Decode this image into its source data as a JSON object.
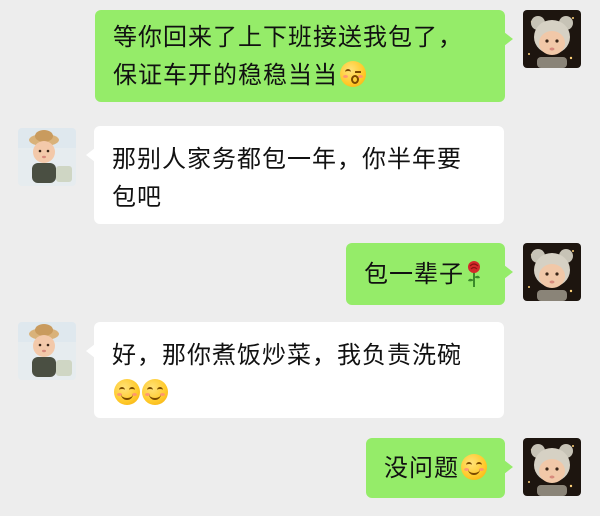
{
  "messages": [
    {
      "side": "sent",
      "text": "等你回来了上下班接送我包了，保证车开的稳稳当当",
      "emoji": "kissing-wink-emoji"
    },
    {
      "side": "received",
      "text": "那别人家务都包一年，你半年要包吧",
      "emoji": ""
    },
    {
      "side": "sent",
      "text": "包一辈子",
      "emoji": "rose-emoji"
    },
    {
      "side": "received",
      "text": "好，那你煮饭炒菜，我负责洗碗",
      "emoji": "smiling-face-emoji"
    },
    {
      "side": "sent",
      "text": "没问题",
      "emoji": "smiling-face-emoji"
    }
  ],
  "colors": {
    "background": "#ededed",
    "sent_bubble": "#95ec69",
    "received_bubble": "#ffffff"
  },
  "avatars": {
    "self": "baby-in-bear-hat-avatar",
    "other": "baby-in-straw-hat-avatar"
  }
}
